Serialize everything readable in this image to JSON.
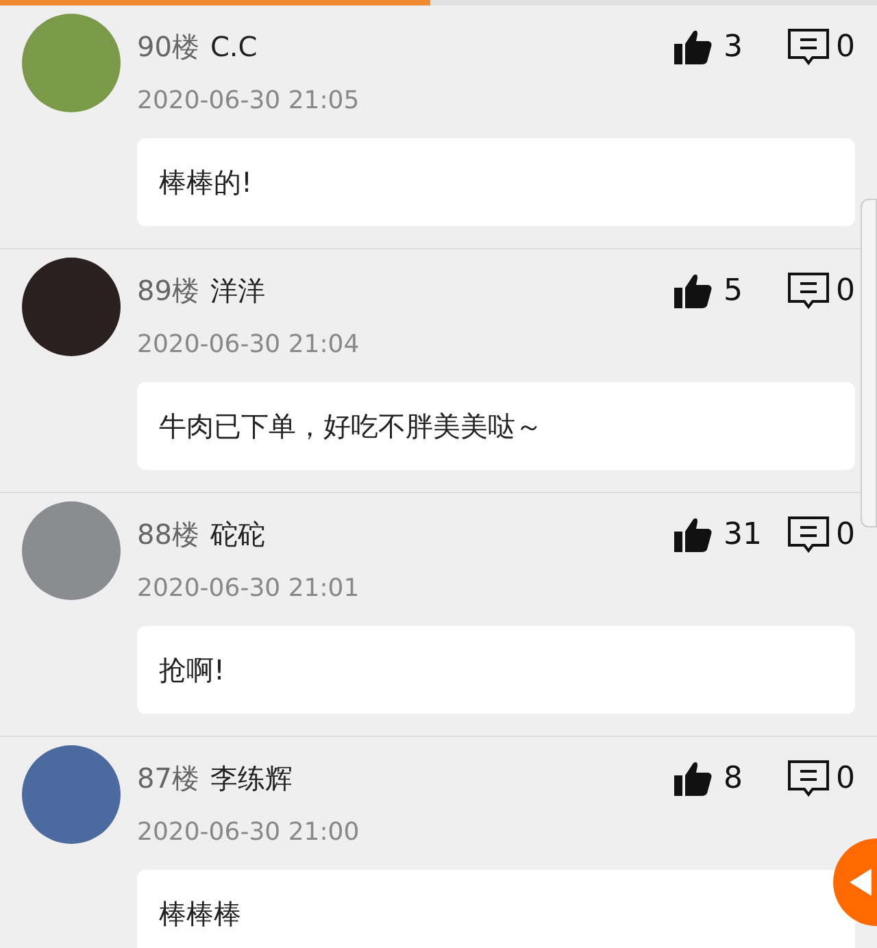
{
  "progress": {
    "level": 0.49
  },
  "comments": [
    {
      "floor": "90楼",
      "user": "C.C",
      "time": "2020-06-30 21:05",
      "likes": "3",
      "replies": "0",
      "text": "棒棒的!"
    },
    {
      "floor": "89楼",
      "user": "洋洋",
      "time": "2020-06-30 21:04",
      "likes": "5",
      "replies": "0",
      "text": "牛肉已下单，好吃不胖美美哒～"
    },
    {
      "floor": "88楼",
      "user": "砣砣",
      "time": "2020-06-30 21:01",
      "likes": "31",
      "replies": "0",
      "text": "抢啊!"
    },
    {
      "floor": "87楼",
      "user": "李练辉",
      "time": "2020-06-30 21:00",
      "likes": "8",
      "replies": "0",
      "text": "棒棒棒"
    }
  ]
}
